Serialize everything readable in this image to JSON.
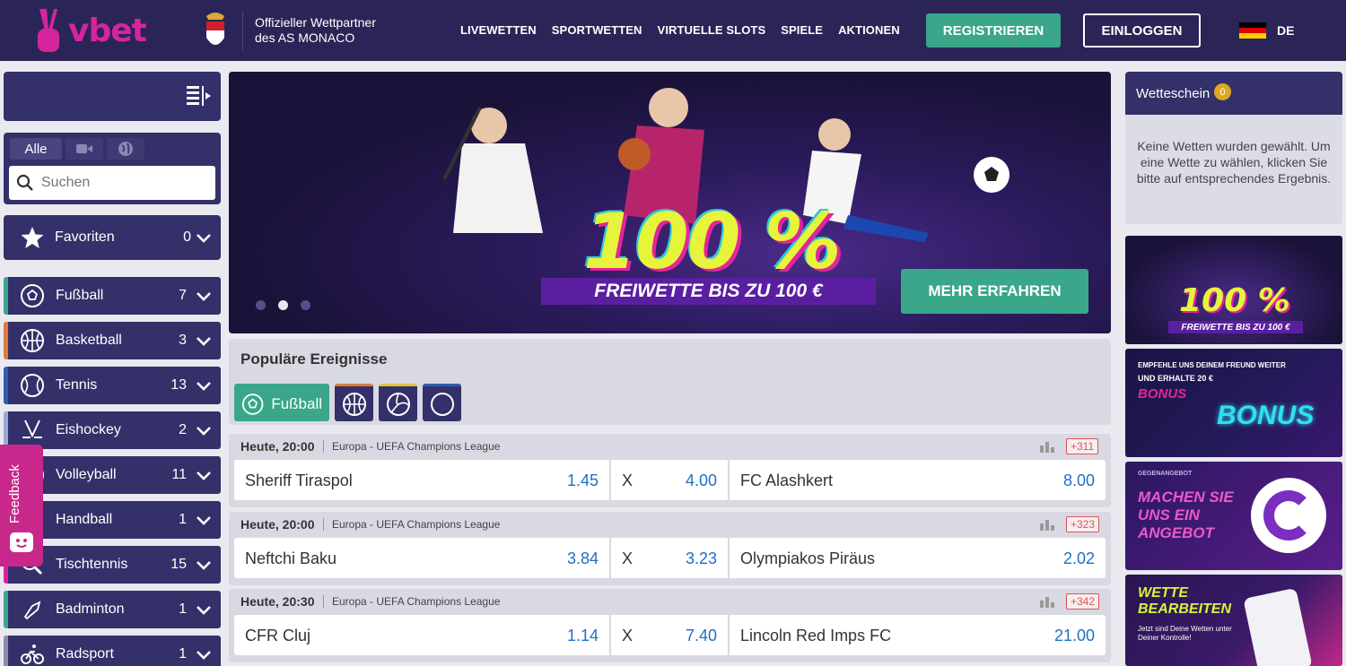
{
  "header": {
    "logo_text": "vbet",
    "partner_line1": "Offizieller Wettpartner",
    "partner_line2": "des AS MONACO",
    "nav": [
      "LIVEWETTEN",
      "SPORTWETTEN",
      "VIRTUELLE SLOTS",
      "SPIELE",
      "AKTIONEN"
    ],
    "register_label": "REGISTRIEREN",
    "login_label": "EINLOGGEN",
    "language": "DE"
  },
  "sidebar": {
    "tab_all": "Alle",
    "search_placeholder": "Suchen",
    "favorites_label": "Favoriten",
    "favorites_count": "0",
    "sports": [
      {
        "label": "Fußball",
        "count": "7",
        "icon": "football-icon",
        "accent": "#3aa68a"
      },
      {
        "label": "Basketball",
        "count": "3",
        "icon": "basketball-icon",
        "accent": "#e07a3a"
      },
      {
        "label": "Tennis",
        "count": "13",
        "icon": "tennis-icon",
        "accent": "#2a5fb0"
      },
      {
        "label": "Eishockey",
        "count": "2",
        "icon": "icehockey-icon",
        "accent": "#9aa8d8"
      },
      {
        "label": "Volleyball",
        "count": "11",
        "icon": "volleyball-icon",
        "accent": "#e0c43a"
      },
      {
        "label": "Handball",
        "count": "1",
        "icon": "handball-icon",
        "accent": "#3aa68a"
      },
      {
        "label": "Tischtennis",
        "count": "15",
        "icon": "tabletennis-icon",
        "accent": "#d6249f"
      },
      {
        "label": "Badminton",
        "count": "1",
        "icon": "badminton-icon",
        "accent": "#3aa68a"
      },
      {
        "label": "Radsport",
        "count": "1",
        "icon": "cycling-icon",
        "accent": "#8a8fa8"
      }
    ],
    "feedback_label": "Feedback"
  },
  "banner": {
    "headline": "100 %",
    "subline": "FREIWETTE BIS ZU 100 €",
    "cta": "MEHR ERFAHREN",
    "active_slide": 2,
    "slide_count": 3
  },
  "popular": {
    "title": "Populäre Ereignisse",
    "active_tab": "Fußball"
  },
  "matches": [
    {
      "time": "Heute, 20:00",
      "league": "Europa - UEFA Champions League",
      "more": "+311",
      "home": "Sheriff Tiraspol",
      "home_odd": "1.45",
      "draw": "X",
      "draw_odd": "4.00",
      "away": "FC Alashkert",
      "away_odd": "8.00"
    },
    {
      "time": "Heute, 20:00",
      "league": "Europa - UEFA Champions League",
      "more": "+323",
      "home": "Neftchi Baku",
      "home_odd": "3.84",
      "draw": "X",
      "draw_odd": "3.23",
      "away": "Olympiakos Piräus",
      "away_odd": "2.02"
    },
    {
      "time": "Heute, 20:30",
      "league": "Europa - UEFA Champions League",
      "more": "+342",
      "home": "CFR Cluj",
      "home_odd": "1.14",
      "draw": "X",
      "draw_odd": "7.40",
      "away": "Lincoln Red Imps FC",
      "away_odd": "21.00"
    }
  ],
  "betslip": {
    "title": "Wetteschein",
    "count": "0",
    "message": "Keine Wetten wurden gewählt. Um eine Wette zu wählen, klicken Sie bitte auf entsprechendes Ergebnis."
  },
  "promos": {
    "p1_headline": "100 %",
    "p1_sub": "FREIWETTE BIS ZU 100 €",
    "p2_line1": "EMPFEHLE UNS DEINEM FREUND WEITER",
    "p2_line2": "UND ERHALTE 20 €",
    "p2_line3": "BONUS",
    "p2_neon": "BONUS",
    "p3_line1": "GEGENANGEBOT",
    "p3_line2": "MACHEN SIE UNS EIN ANGEBOT",
    "p4_line1": "WETTE BEARBEITEN",
    "p4_line2": "Jetzt sind Deine Wetten unter Deiner Kontrolle!"
  },
  "colors": {
    "header_bg": "#2a2556",
    "panel_bg": "#34306a",
    "accent_green": "#3aa68a",
    "brand_pink": "#d6249f",
    "odd_blue": "#1f6fc5"
  }
}
